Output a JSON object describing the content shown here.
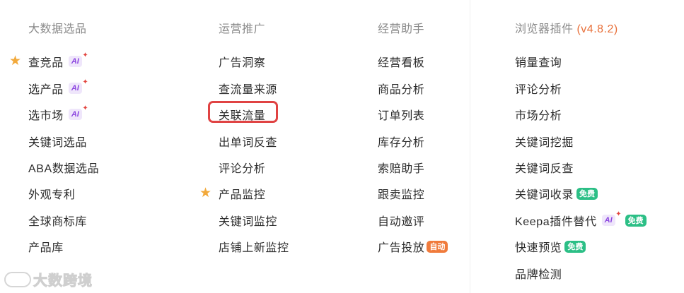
{
  "columns": [
    {
      "heading": "大数据选品",
      "items": [
        {
          "label": "查竞品",
          "star": true,
          "ai": true
        },
        {
          "label": "选产品",
          "ai": true
        },
        {
          "label": "选市场",
          "ai": true
        },
        {
          "label": "关键词选品"
        },
        {
          "label": "ABA数据选品"
        },
        {
          "label": "外观专利"
        },
        {
          "label": "全球商标库"
        },
        {
          "label": "产品库"
        }
      ]
    },
    {
      "heading": "运营推广",
      "items": [
        {
          "label": "广告洞察"
        },
        {
          "label": "查流量来源"
        },
        {
          "label": "关联流量",
          "highlighted": true
        },
        {
          "label": "出单词反查"
        },
        {
          "label": "评论分析"
        },
        {
          "label": "产品监控",
          "star": true
        },
        {
          "label": "关键词监控"
        },
        {
          "label": "店铺上新监控"
        }
      ]
    },
    {
      "heading": "经营助手",
      "items": [
        {
          "label": "经营看板"
        },
        {
          "label": "商品分析"
        },
        {
          "label": "订单列表"
        },
        {
          "label": "库存分析"
        },
        {
          "label": "索赔助手"
        },
        {
          "label": "跟卖监控"
        },
        {
          "label": "自动邀评"
        },
        {
          "label": "广告投放",
          "badge": "自动"
        }
      ]
    },
    {
      "heading": "浏览器插件",
      "heading_version": "(v4.8.2)",
      "items": [
        {
          "label": "销量查询"
        },
        {
          "label": "评论分析"
        },
        {
          "label": "市场分析"
        },
        {
          "label": "关键词挖掘"
        },
        {
          "label": "关键词反查"
        },
        {
          "label": "关键词收录",
          "badge": "免费"
        },
        {
          "label": "Keepa插件替代",
          "ai": true,
          "badge": "免费"
        },
        {
          "label": "快速预览",
          "badge": "免费"
        },
        {
          "label": "品牌检测"
        }
      ]
    }
  ],
  "ai_badge_label": "AI",
  "ai_badge_sparkle": "✦",
  "star_icon": "★",
  "watermark": "大数跨境",
  "colors": {
    "star": "#f2a93b",
    "ai_text": "#8d47e0",
    "ai_bg": "#efe6fb",
    "free_badge": "#2cbf86",
    "auto_badge": "#f07b3c",
    "version": "#e8703a",
    "highlight_border": "#e04343"
  }
}
